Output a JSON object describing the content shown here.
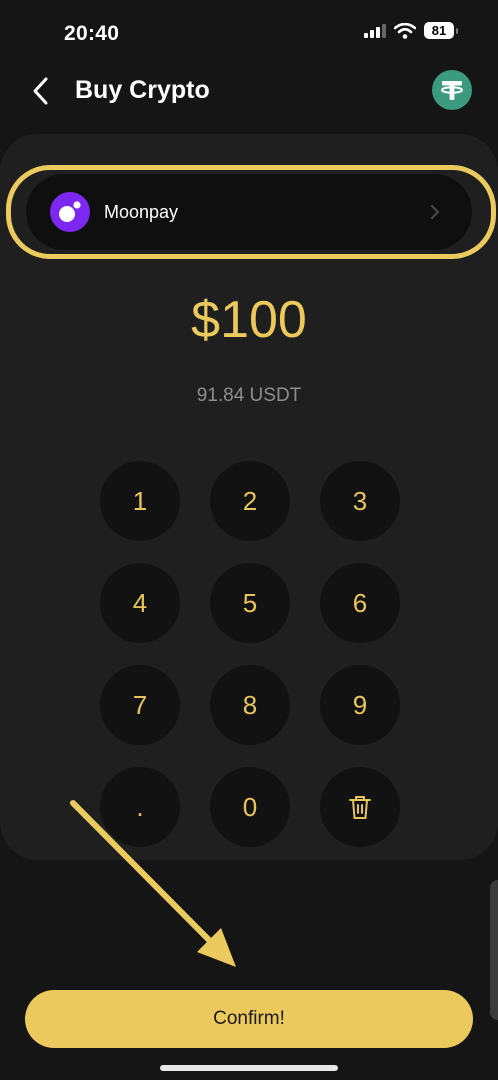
{
  "status_bar": {
    "time": "20:40",
    "battery": "81"
  },
  "header": {
    "title": "Buy Crypto",
    "token_icon": "tether-icon"
  },
  "provider": {
    "name": "Moonpay"
  },
  "amount": {
    "fiat": "$100",
    "crypto": "91.84 USDT"
  },
  "keypad": {
    "keys": [
      "1",
      "2",
      "3",
      "4",
      "5",
      "6",
      "7",
      "8",
      "9",
      ".",
      "0"
    ],
    "delete_icon": "trash-icon"
  },
  "confirm": {
    "label": "Confirm!"
  },
  "colors": {
    "accent": "#ecc95c",
    "background": "#151515",
    "panel": "#1f1f1f",
    "moonpay": "#7d28f0",
    "tether": "#3c9b7e"
  }
}
